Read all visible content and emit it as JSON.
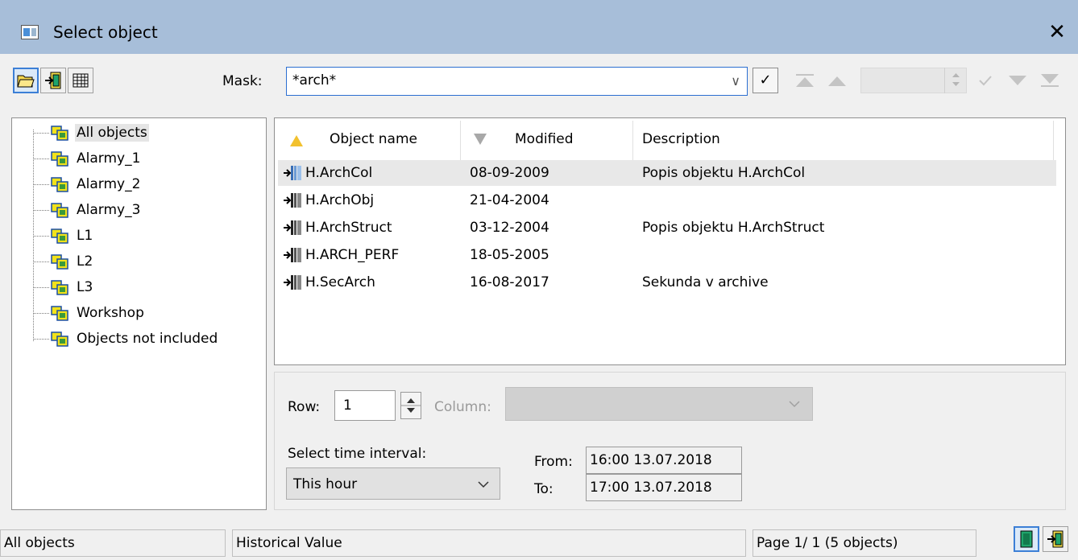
{
  "window": {
    "title": "Select object",
    "close_glyph": "✕"
  },
  "toolbar": {
    "buttons": [
      {
        "icon": "open-folder-icon"
      },
      {
        "icon": "exit-door-icon"
      },
      {
        "icon": "grid-icon"
      }
    ],
    "mask_label": "Mask:",
    "mask_value": "*arch*",
    "mask_dropdown_glyph": "∨",
    "mask_ok_glyph": "✓",
    "nav_buttons": [
      "first-page-icon",
      "prev-page-icon",
      "confirm-icon",
      "next-page-icon",
      "last-page-icon"
    ]
  },
  "tree": {
    "items": [
      {
        "label": "All objects",
        "selected": true
      },
      {
        "label": "Alarmy_1"
      },
      {
        "label": "Alarmy_2"
      },
      {
        "label": "Alarmy_3"
      },
      {
        "label": "L1"
      },
      {
        "label": "L2"
      },
      {
        "label": "L3"
      },
      {
        "label": "Workshop"
      },
      {
        "label": "Objects not included"
      }
    ]
  },
  "list": {
    "columns": [
      {
        "label": "Object name",
        "sort": "asc"
      },
      {
        "label": "Modified",
        "sort": "desc"
      },
      {
        "label": "Description"
      }
    ],
    "rows": [
      {
        "name": "H.ArchCol",
        "modified": "08-09-2009",
        "description": "Popis objektu H.ArchCol",
        "selected": true
      },
      {
        "name": "H.ArchObj",
        "modified": "21-04-2004",
        "description": ""
      },
      {
        "name": "H.ArchStruct",
        "modified": "03-12-2004",
        "description": "Popis objektu H.ArchStruct"
      },
      {
        "name": "H.ARCH_PERF",
        "modified": "18-05-2005",
        "description": ""
      },
      {
        "name": "H.SecArch",
        "modified": "16-08-2017",
        "description": "Sekunda v archive"
      }
    ]
  },
  "panel": {
    "row_label": "Row:",
    "row_value": "1",
    "column_label": "Column:",
    "time_interval_label": "Select time interval:",
    "time_interval_value": "This hour",
    "from_label": "From:",
    "from_value": "16:00 13.07.2018",
    "to_label": "To:",
    "to_value": "17:00 13.07.2018"
  },
  "status": {
    "group": "All objects",
    "value_type": "Historical Value",
    "page_info": "Page  1/ 1   (5 objects)"
  },
  "colors": {
    "titlebar": "#a7bed9",
    "accent": "#2c6fd1",
    "group_icon": "#f2e21a",
    "group_icon_border": "#1b4fa3"
  }
}
